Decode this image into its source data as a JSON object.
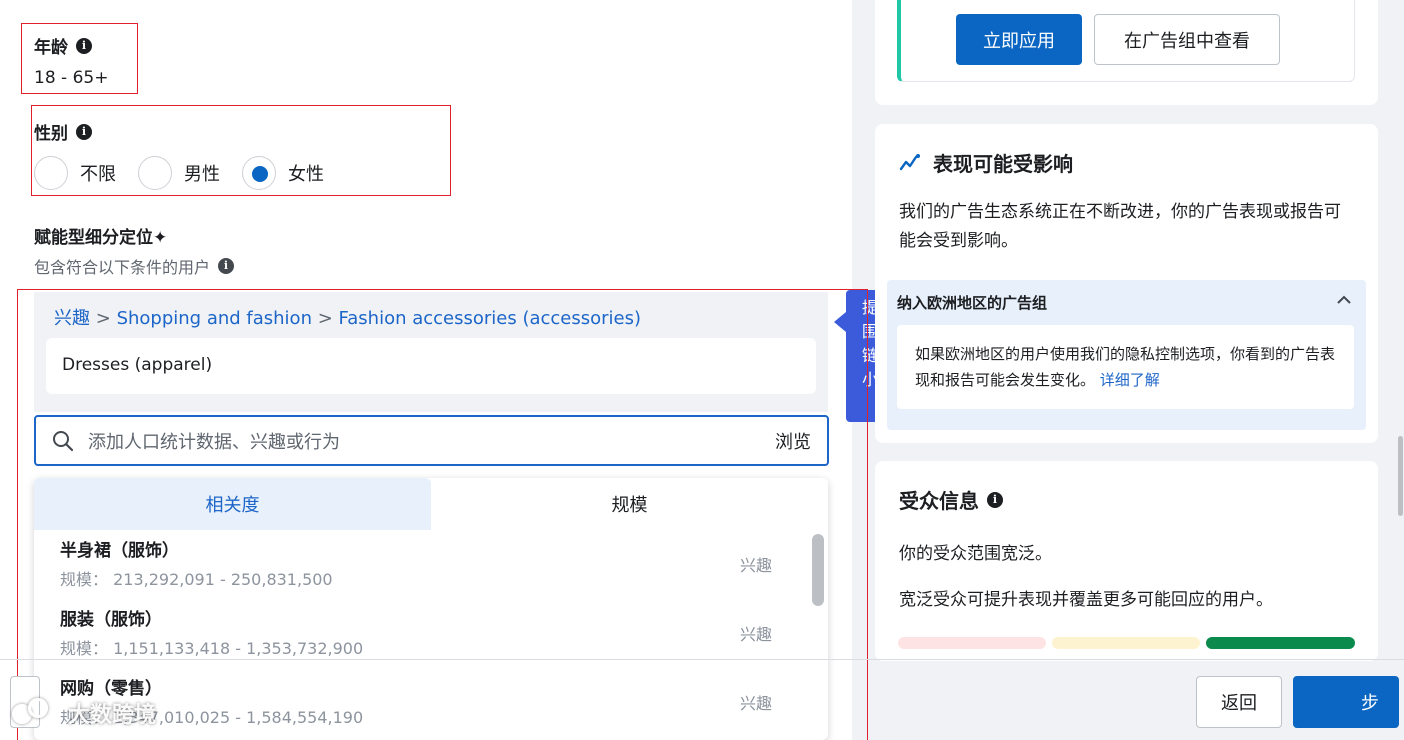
{
  "age": {
    "label": "年龄",
    "value": "18 - 65+"
  },
  "gender": {
    "label": "性别",
    "options": [
      {
        "label": "不限",
        "selected": false
      },
      {
        "label": "男性",
        "selected": false
      },
      {
        "label": "女性",
        "selected": true
      }
    ]
  },
  "detailed_targeting": {
    "title": "赋能型细分定位✦",
    "subtitle": "包含符合以下条件的用户",
    "breadcrumb": [
      "兴趣",
      "Shopping and fashion",
      "Fashion accessories (accessories)"
    ],
    "breadcrumb_sep": ">",
    "selected_chip": "Dresses (apparel)",
    "side_tab_text": "提围链小",
    "search": {
      "placeholder": "添加人口统计数据、兴趣或行为",
      "browse_label": "浏览"
    },
    "tabs": [
      {
        "label": "相关度",
        "active": true
      },
      {
        "label": "规模",
        "active": false
      }
    ],
    "results": [
      {
        "name": "半身裙（服饰）",
        "size": "规模： 213,292,091 - 250,831,500",
        "type": "兴趣"
      },
      {
        "name": "服装（服饰）",
        "size": "规模： 1,151,133,418 - 1,353,732,900",
        "type": "兴趣"
      },
      {
        "name": "网购（零售）",
        "size": "规模： 1,347,010,025 - 1,584,554,190",
        "type": "兴趣"
      }
    ]
  },
  "suggestion_card": {
    "apply_label": "立即应用",
    "view_label": "在广告组中查看"
  },
  "performance_card": {
    "title": "表现可能受影响",
    "description": "我们的广告生态系统正在不断改进，你的广告表现或报告可能会受到影响。",
    "accordion": {
      "header": "纳入欧洲地区的广告组",
      "body": "如果欧洲地区的用户使用我们的隐私控制选项，你看到的广告表现和报告可能会发生变化。",
      "link": "详细了解"
    }
  },
  "audience_card": {
    "title": "受众信息",
    "line1": "你的受众范围宽泛。",
    "line2": "宽泛受众可提升表现并覆盖更多可能回应的用户。",
    "meter_colors": [
      "#fde3e3",
      "#fdf3d0",
      "#0b8a4e"
    ]
  },
  "footer": {
    "back_label": "返回",
    "next_label": "步"
  },
  "watermark": {
    "text": "大数跨境"
  },
  "colors": {
    "primary": "#0a66c2",
    "link": "#1d66c9",
    "highlight_box": "#e0202a"
  }
}
